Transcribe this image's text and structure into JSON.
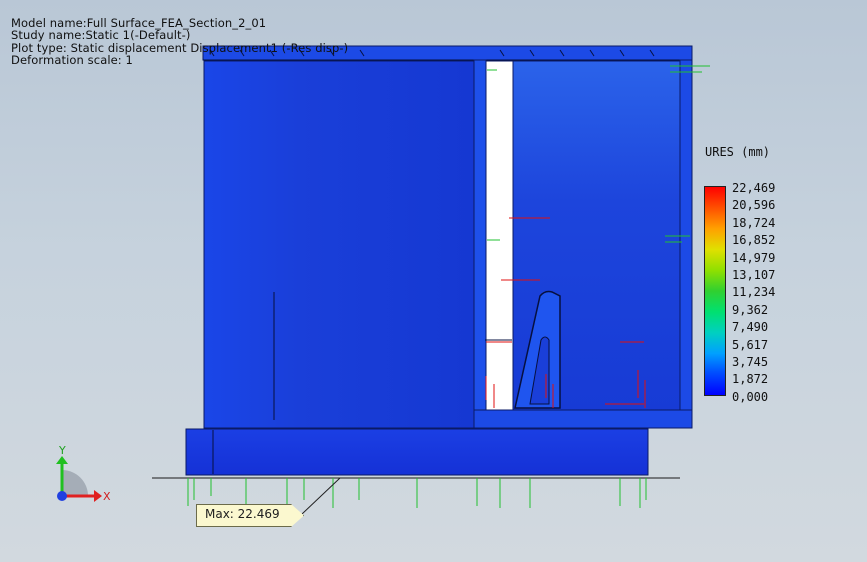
{
  "info": {
    "model_name": "Model name:Full Surface_FEA_Section_2_01",
    "study_name": "Study name:Static 1(-Default-)",
    "plot_type": "Plot type: Static displacement Displacement1 (-Res disp-)",
    "deformation_scale": "Deformation scale: 1"
  },
  "legend": {
    "title": "URES (mm)",
    "values": [
      "22,469",
      "20,596",
      "18,724",
      "16,852",
      "14,979",
      "13,107",
      "11,234",
      "9,362",
      "7,490",
      "5,617",
      "3,745",
      "1,872",
      "0,000"
    ]
  },
  "callout": {
    "label": "Max: 22.469"
  },
  "triad": {
    "x_label": "X",
    "y_label": "Y"
  },
  "colors": {
    "min": "#0000ff",
    "max": "#ff0000",
    "model_blue": "#1540e0",
    "background": "#c6d2dd",
    "callout_fill": "#fbf8cf"
  }
}
